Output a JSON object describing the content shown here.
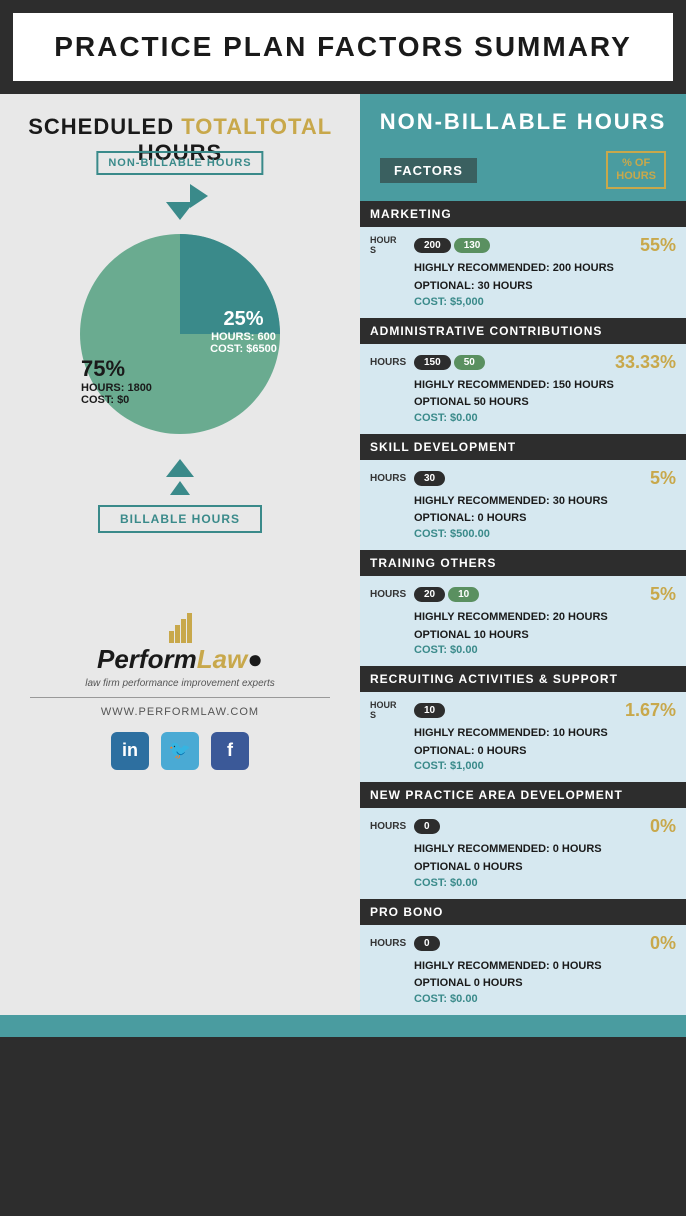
{
  "header": {
    "title": "PRACTICE PLAN FACTORS SUMMARY"
  },
  "left_panel": {
    "scheduled_label_1": "SCHEDULED",
    "scheduled_label_2": "TOTAL",
    "scheduled_label_3": "HOURS",
    "non_billable_box": "NON-BILLABLE HOURS",
    "billable_box": "BILLABLE HOURS",
    "pie_25_percent": "25%",
    "pie_25_hours_label": "HOURS:",
    "pie_25_hours_value": "600",
    "pie_25_cost_label": "COST:",
    "pie_25_cost_value": "$6500",
    "pie_75_percent": "75%",
    "pie_75_hours_label": "HOURS:",
    "pie_75_hours_value": "1800",
    "pie_75_cost_label": "COST:",
    "pie_75_cost_value": "$0",
    "logo_perform": "Perform",
    "logo_law": "Law",
    "logo_tagline": "law firm performance improvement experts",
    "logo_website": "WWW.PERFORMLAW.COM"
  },
  "right_panel": {
    "title": "NON-BILLABLE HOURS",
    "factors_label": "FACTORS",
    "pct_label": "% OF\nHOURS",
    "sections": [
      {
        "id": "marketing",
        "header": "MARKETING",
        "hours_label": "HOUR\nS",
        "pill1": "200",
        "pill2": "130",
        "pct": "55%",
        "line1": "HIGHLY RECOMMENDED: 200 Hours",
        "line2": "OPTIONAL: 30 Hours",
        "cost": "COST: $5,000"
      },
      {
        "id": "admin",
        "header": "ADMINISTRATIVE CONTRIBUTIONS",
        "hours_label": "HOURS",
        "pill1": "150",
        "pill2": "50",
        "pct": "33.33%",
        "line1": "HIGHLY RECOMMENDED: 150 Hours",
        "line2": "OPTIONAL  50 Hours",
        "cost": "COST: $0.00"
      },
      {
        "id": "skill",
        "header": "SKILL DEVELOPMENT",
        "hours_label": "HOURS",
        "pill1": "30",
        "pill2": null,
        "pct": "5%",
        "line1": "HIGHLY RECOMMENDED: 30 HOURS",
        "line2": "OPTIONAL: 0 Hours",
        "cost": "COST: $500.00"
      },
      {
        "id": "training",
        "header": "TRAINING OTHERS",
        "hours_label": "HOURS",
        "pill1": "20",
        "pill2": "10",
        "pct": "5%",
        "line1": "HIGHLY RECOMMENDED: 20 Hours",
        "line2": "OPTIONAL  10 Hours",
        "cost": "COST: $0.00"
      },
      {
        "id": "recruiting",
        "header": "RECRUITING ACTIVITIES & SUPPORT",
        "hours_label": "HOUR\nS",
        "pill1": "10",
        "pill2": null,
        "pct": "1.67%",
        "line1": "HIGHLY RECOMMENDED: 10 Hours",
        "line2": "OPTIONAL: 0 Hours",
        "cost": "COST: $1,000"
      },
      {
        "id": "new-practice",
        "header": "NEW PRACTICE AREA DEVELOPMENT",
        "hours_label": "HOURS",
        "pill1": "0",
        "pill2": null,
        "pct": "0%",
        "line1": "HIGHLY RECOMMENDED: 0 Hours",
        "line2": "OPTIONAL  0 Hours",
        "cost": "COST: $0.00"
      },
      {
        "id": "pro-bono",
        "header": "PRO BONO",
        "hours_label": "HOURS",
        "pill1": "0",
        "pill2": null,
        "pct": "0%",
        "line1": "HIGHLY RECOMMENDED: 0 Hours",
        "line2": "OPTIONAL  0 Hours",
        "cost": "COST: $0.00"
      }
    ]
  }
}
